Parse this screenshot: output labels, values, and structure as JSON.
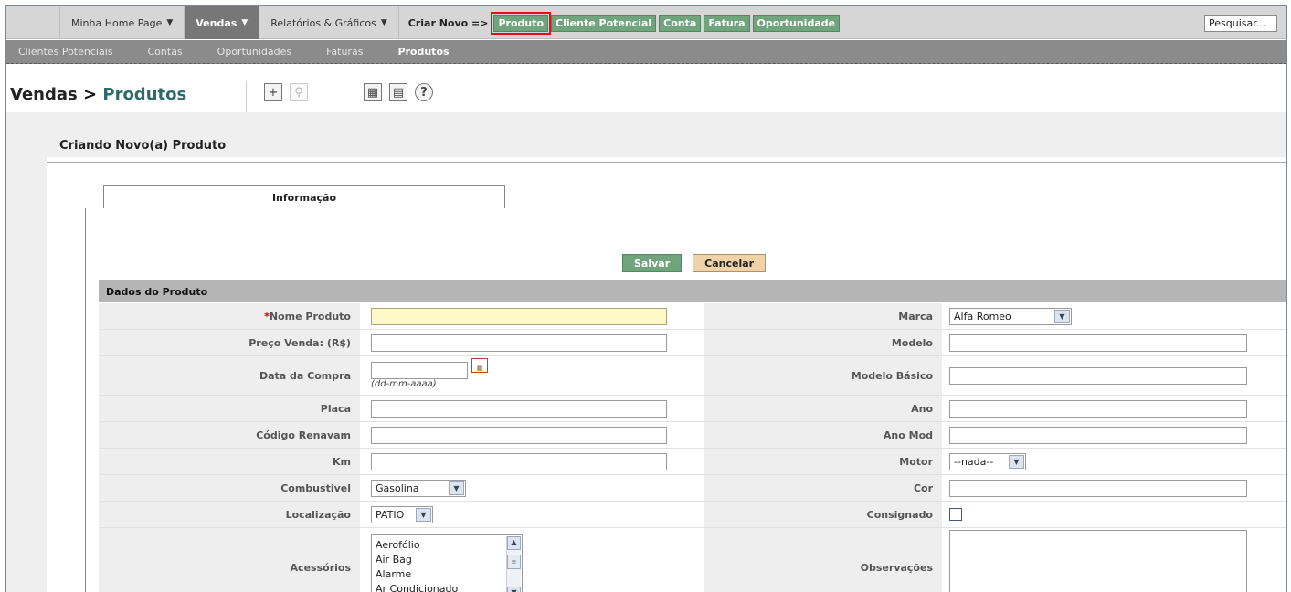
{
  "nav": {
    "menus": [
      "Minha Home Page",
      "Vendas",
      "Relatórios & Gráficos"
    ],
    "criar_label": "Criar Novo =>",
    "quick_create": [
      "Produto",
      "Cliente Potencial",
      "Conta",
      "Fatura",
      "Oportunidade"
    ],
    "search_value": "Pesquisar..."
  },
  "subnav": [
    "Clientes Potenciais",
    "Contas",
    "Oportunidades",
    "Faturas",
    "Produtos"
  ],
  "page": {
    "module": "Vendas",
    "separator": ">",
    "current": "Produtos",
    "subtitle": "Criando Novo(a) Produto",
    "tab": "Informação",
    "save": "Salvar",
    "cancel": "Cancelar",
    "section": "Dados do Produto"
  },
  "fields": {
    "nome": "Nome Produto",
    "preco": "Preço Venda: (R$)",
    "data": "Data da Compra",
    "date_hint": "(dd-mm-aaaa)",
    "placa": "Placa",
    "renavam": "Código Renavam",
    "km": "Km",
    "combustivel": "Combustivel",
    "combustivel_value": "Gasolina",
    "localizacao": "Localização",
    "localizacao_value": "PATIO",
    "acessorios": "Acessórios",
    "acessorios_options": [
      "Aerofólio",
      "Air Bag",
      "Alarme",
      "Ar Condicionado"
    ],
    "marca": "Marca",
    "marca_value": "Alfa Romeo",
    "modelo": "Modelo",
    "modelo_basico": "Modelo Básico",
    "ano": "Ano",
    "ano_mod": "Ano Mod",
    "motor": "Motor",
    "motor_value": "--nada--",
    "cor": "Cor",
    "consignado": "Consignado",
    "observacoes": "Observações"
  },
  "colors": {
    "accent_green": "#6fa47d",
    "cancel_tan": "#efd3a7",
    "title_teal": "#2d6a6a"
  }
}
